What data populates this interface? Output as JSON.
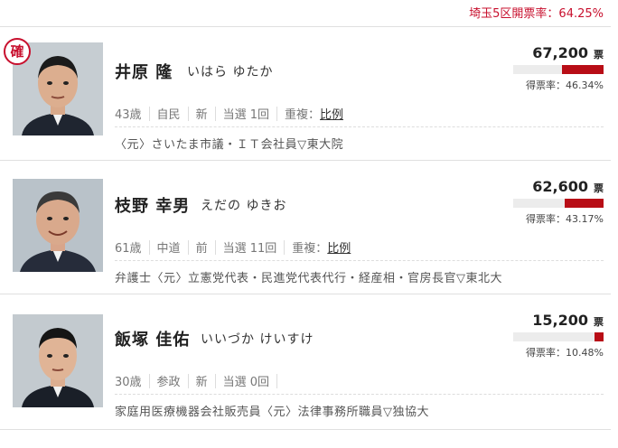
{
  "header": {
    "opening_rate": "埼玉5区開票率：64.25%"
  },
  "candidates": [
    {
      "elected_badge": "確",
      "name": "井原 隆",
      "kana": "いはら ゆたか",
      "age": "43歳",
      "party": "自民",
      "status": "新",
      "wins": "当選 1回",
      "dup_label": "重複：",
      "dup_link": "比例",
      "career": "〈元〉さいたま市議・ＩＴ会社員▽東大院",
      "votes": "67,200",
      "vote_unit": "票",
      "rate": "得票率：46.34%",
      "rate_fraction": 0.4634
    },
    {
      "name": "枝野 幸男",
      "kana": "えだの ゆきお",
      "age": "61歳",
      "party": "中道",
      "status": "前",
      "wins": "当選 11回",
      "dup_label": "重複：",
      "dup_link": "比例",
      "career": "弁護士〈元〉立憲党代表・民進党代表代行・経産相・官房長官▽東北大",
      "votes": "62,600",
      "vote_unit": "票",
      "rate": "得票率：43.17%",
      "rate_fraction": 0.4317
    },
    {
      "name": "飯塚 佳佑",
      "kana": "いいづか けいすけ",
      "age": "30歳",
      "party": "参政",
      "status": "新",
      "wins": "当選 0回",
      "career": "家庭用医療機器会社販売員〈元〉法律事務所職員▽独協大",
      "votes": "15,200",
      "vote_unit": "票",
      "rate": "得票率：10.48%",
      "rate_fraction": 0.1048
    }
  ],
  "colors": {
    "accent": "#c8102e",
    "bar_fill": "#b80d16",
    "bar_bg": "#ececec"
  }
}
